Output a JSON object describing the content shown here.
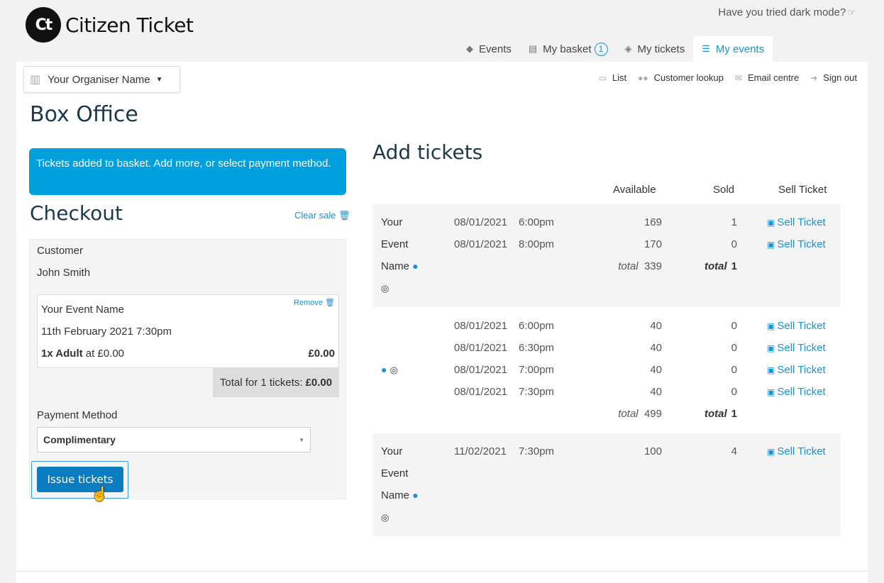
{
  "header": {
    "logo_mark": "Ct",
    "logo_text": "Citizen Ticket",
    "dark_mode_prompt": "Have you tried dark mode?",
    "tabs": [
      {
        "label": "Events",
        "icon": "tags-icon"
      },
      {
        "label": "My basket",
        "icon": "basket-icon",
        "count": "1"
      },
      {
        "label": "My tickets",
        "icon": "ticket-icon"
      },
      {
        "label": "My events",
        "icon": "sliders-icon",
        "active": true
      }
    ]
  },
  "organiser": {
    "name": "Your Organiser Name"
  },
  "subnav": [
    "List",
    "Customer lookup",
    "Email centre",
    "Sign out"
  ],
  "page_title": "Box Office",
  "alert": "Tickets added to basket. Add more, or select payment method.",
  "checkout": {
    "title": "Checkout",
    "clear_sale": "Clear sale",
    "customer_label": "Customer",
    "customer_name": "John Smith",
    "item": {
      "remove": "Remove",
      "event_name": "Your Event Name",
      "date": "11th February 2021 7:30pm",
      "qty": "1x Adult",
      "at": "at £0.00",
      "price": "£0.00"
    },
    "total_label": "Total for 1 tickets:",
    "total_value": "£0.00",
    "payment_label": "Payment Method",
    "payment_value": "Complimentary",
    "issue_label": "Issue tickets"
  },
  "add_tickets": {
    "title": "Add tickets",
    "headers": {
      "available": "Available",
      "sold": "Sold",
      "sell": "Sell Ticket"
    },
    "sell_label": "Sell Ticket",
    "total_word": "total",
    "groups": [
      {
        "name_lines": [
          "Your",
          "Event",
          "Name"
        ],
        "rows": [
          {
            "date": "08/01/2021",
            "time": "6:00pm",
            "available": "169",
            "sold": "1"
          },
          {
            "date": "08/01/2021",
            "time": "8:00pm",
            "available": "170",
            "sold": "0"
          }
        ],
        "total_available": "339",
        "total_sold": "1"
      },
      {
        "name_lines": [],
        "rows": [
          {
            "date": "08/01/2021",
            "time": "6:00pm",
            "available": "40",
            "sold": "0"
          },
          {
            "date": "08/01/2021",
            "time": "6:30pm",
            "available": "40",
            "sold": "0"
          },
          {
            "date": "08/01/2021",
            "time": "7:00pm",
            "available": "40",
            "sold": "0"
          },
          {
            "date": "08/01/2021",
            "time": "7:30pm",
            "available": "40",
            "sold": "0"
          }
        ],
        "total_available": "499",
        "total_sold": "1"
      },
      {
        "name_lines": [
          "Your",
          "Event",
          "Name"
        ],
        "rows": [
          {
            "date": "11/02/2021",
            "time": "7:30pm",
            "available": "100",
            "sold": "4"
          }
        ]
      }
    ]
  }
}
